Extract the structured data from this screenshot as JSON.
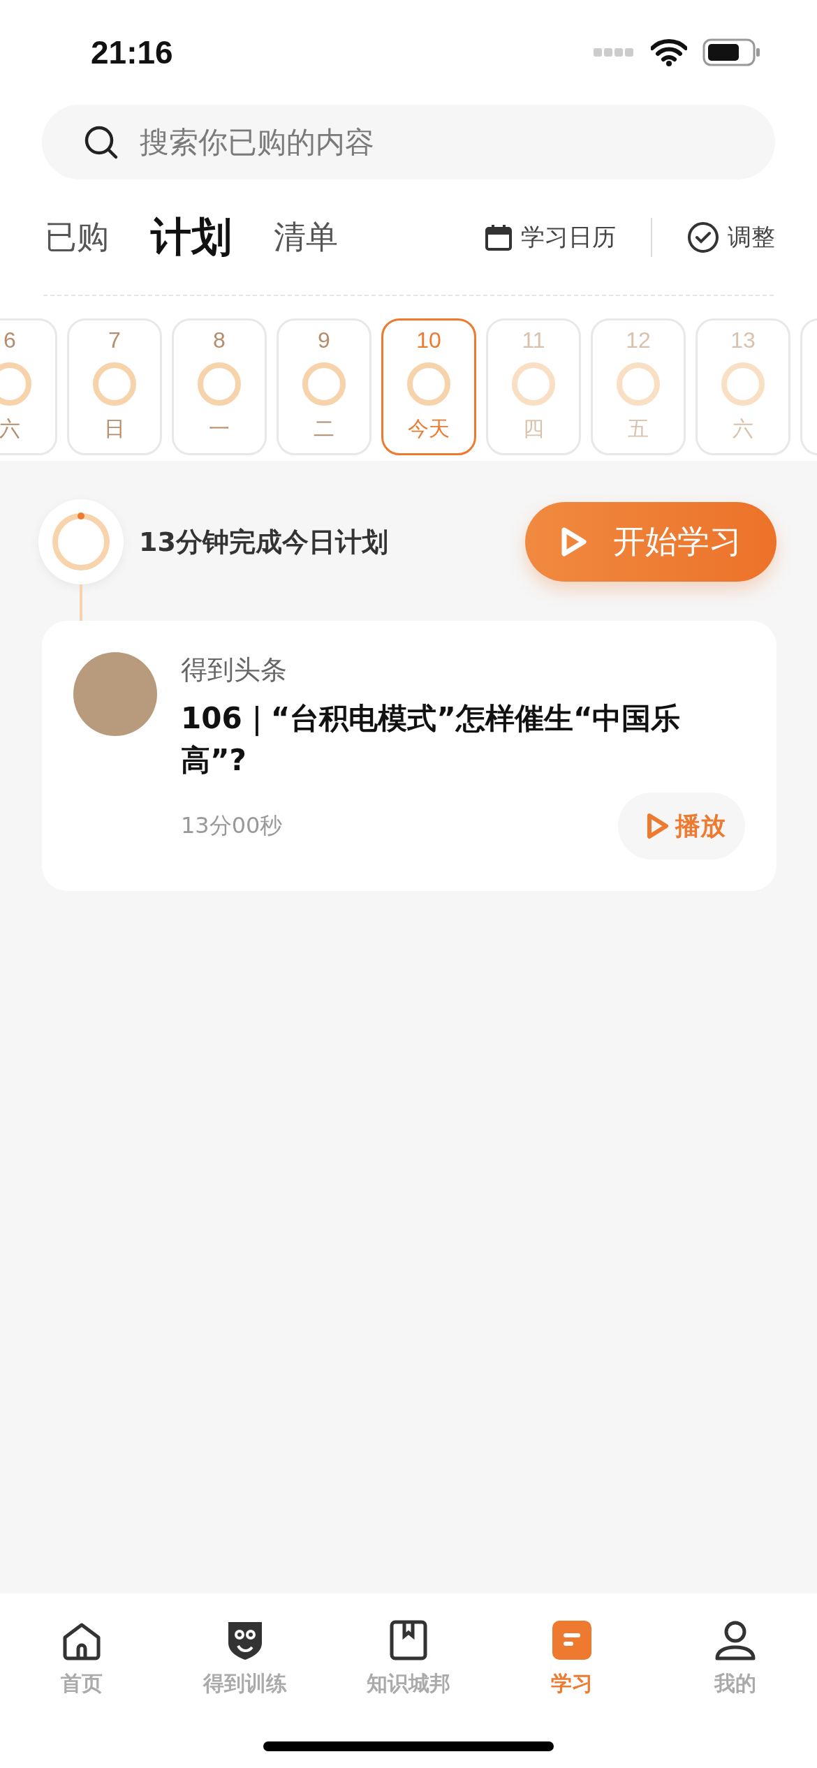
{
  "status_bar": {
    "time": "21:16"
  },
  "search": {
    "placeholder": "搜索你已购的内容"
  },
  "tabs": [
    {
      "label": "已购",
      "selected": false
    },
    {
      "label": "计划",
      "selected": true
    },
    {
      "label": "清单",
      "selected": false
    }
  ],
  "actions": [
    {
      "kind": "calendar",
      "label": "学习日历"
    },
    {
      "kind": "adjust",
      "label": "调整"
    }
  ],
  "days": [
    {
      "day": "6",
      "weekday": "六",
      "kind": "past",
      "selected": false
    },
    {
      "day": "7",
      "weekday": "日",
      "kind": "past",
      "selected": false
    },
    {
      "day": "8",
      "weekday": "一",
      "kind": "past",
      "selected": false
    },
    {
      "day": "9",
      "weekday": "二",
      "kind": "past",
      "selected": false
    },
    {
      "day": "10",
      "weekday": "今天",
      "kind": "today",
      "selected": true
    },
    {
      "day": "11",
      "weekday": "四",
      "kind": "future",
      "selected": false
    },
    {
      "day": "12",
      "weekday": "五",
      "kind": "future",
      "selected": false
    },
    {
      "day": "13",
      "weekday": "六",
      "kind": "future",
      "selected": false
    }
  ],
  "plan": {
    "summary": "13分钟完成今日计划",
    "start_button": "开始学习"
  },
  "items": [
    {
      "source": "得到头条",
      "title": "106｜“台积电模式”怎样催生“中国乐高”?",
      "duration": "13分00秒",
      "play_button": "播放"
    }
  ],
  "nav": [
    {
      "kind": "home",
      "label": "首页",
      "selected": false
    },
    {
      "kind": "owl",
      "label": "得到训练",
      "selected": false
    },
    {
      "kind": "book",
      "label": "知识城邦",
      "selected": false
    },
    {
      "kind": "study",
      "label": "学习",
      "selected": true
    },
    {
      "kind": "user",
      "label": "我的",
      "selected": false
    }
  ]
}
